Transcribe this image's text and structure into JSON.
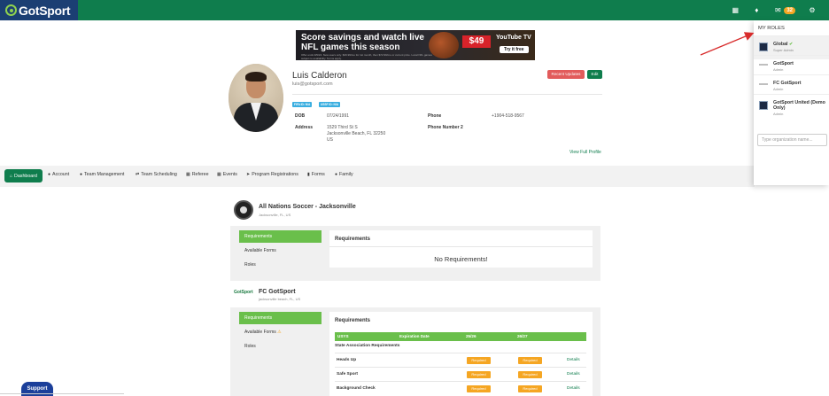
{
  "brand": {
    "name": "GotSport"
  },
  "colors": {
    "primary": "#0f7d4d",
    "accent_green": "#6abf4b",
    "required": "#f5a623",
    "danger": "#e25b5b",
    "arrow": "#d82c2c"
  },
  "header": {
    "icons": [
      "grid-icon",
      "bell-icon",
      "mail-icon",
      "gear-icon"
    ],
    "notifications_count": "32"
  },
  "ad": {
    "headline": "Score savings and watch live NFL games this season",
    "fine_print": "Offer ends 9/9/24. New users only. $49.99/mo for 1st month, then $72.99/mo or current price. Local NFL games subject to availability. Terms apply.",
    "price": "$49",
    "brand": "YouTube TV",
    "cta": "Try it free"
  },
  "profile": {
    "name": "Luis Calderon",
    "email": "luis@gotsport.com",
    "recent_updates_label": "Recent Updates",
    "edit_label": "Edit",
    "badges": [
      "FIFA ID: N/A",
      "USSF ID: N/A"
    ],
    "dob_label": "DOB",
    "dob": "07/24/1991",
    "phone_label": "Phone",
    "phone": "+1904-518-9567",
    "address_label": "Address",
    "address_line1": "1529 Third St S",
    "address_line2": "Jacksonville Beach, FL 32250",
    "address_line3": "US",
    "phone2_label": "Phone Number 2",
    "view_full_profile": "View Full Profile"
  },
  "nav": {
    "items": [
      {
        "label": "Dashboard",
        "icon": "home-icon"
      },
      {
        "label": "Account",
        "icon": "user-icon"
      },
      {
        "label": "Team Management",
        "icon": "users-icon"
      },
      {
        "label": "Team Scheduling",
        "icon": "exchange-icon"
      },
      {
        "label": "Referee",
        "icon": "calendar-icon"
      },
      {
        "label": "Events",
        "icon": "calendar-icon"
      },
      {
        "label": "Program Registrations",
        "icon": "send-icon"
      },
      {
        "label": "Forms",
        "icon": "file-icon"
      },
      {
        "label": "Family",
        "icon": "users-icon"
      }
    ]
  },
  "org1": {
    "name": "All Nations Soccer - Jacksonville",
    "location": "Jacksonville, FL, US",
    "side": [
      "Requirements",
      "Available Forms",
      "Roles"
    ],
    "card_title": "Requirements",
    "empty_text": "No Requirements!"
  },
  "org2": {
    "logo_text": "GotSport",
    "name": "FC GotSport",
    "location": "jacksonville beach, FL, US",
    "side": [
      "Requirements",
      "Available Forms",
      "Roles"
    ],
    "card_title": "Requirements",
    "table_headers": [
      "USYS",
      "Expiration Date",
      "25/26",
      "26/27"
    ],
    "section_label": "State Association Requirements",
    "rows": [
      {
        "label": "Heads Up",
        "status1": "Required",
        "status2": "Required",
        "action": "Details"
      },
      {
        "label": "Safe Sport",
        "status1": "Required",
        "status2": "Required",
        "action": "Details"
      },
      {
        "label": "Background Check",
        "status1": "Required",
        "status2": "Required",
        "action": "Details"
      }
    ]
  },
  "support": {
    "label": "Support"
  },
  "roles": {
    "title": "MY ROLES",
    "items": [
      {
        "name": "Global",
        "sub": "Super Admin"
      },
      {
        "name": "GotSport",
        "sub": "Admin"
      },
      {
        "name": "FC GotSport",
        "sub": "Admin"
      },
      {
        "name": "GotSport United (Demo Only)",
        "sub": "Admin"
      }
    ],
    "search_placeholder": "Type organization name..."
  }
}
